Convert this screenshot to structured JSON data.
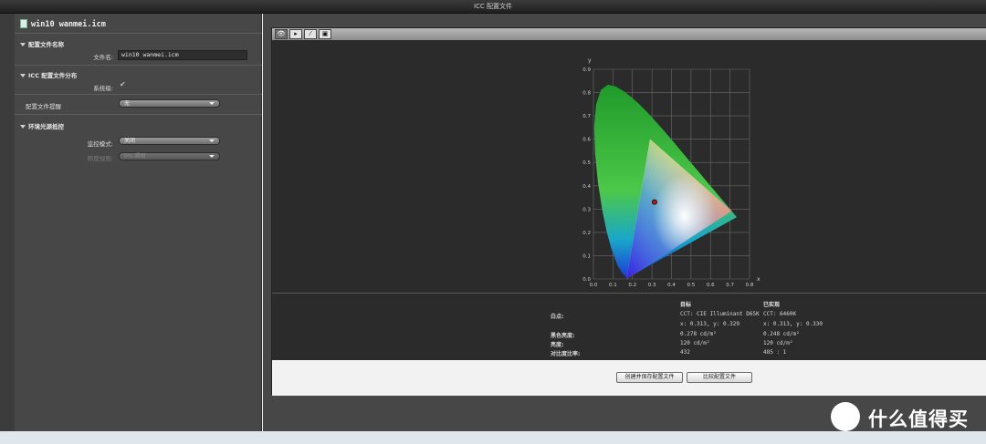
{
  "window": {
    "title": "ICC 配置文件"
  },
  "sidebar": {
    "file_title": "win10 wanmei.icm",
    "sec_name": "配置文件名称",
    "filename_label": "文件名:",
    "filename_value": "win10 wanmei.icm",
    "sec_dist": "ICC 配置文件分布",
    "system_label": "系统级:",
    "preview_label": "配置文件提醒",
    "preview_value": "无",
    "sec_ambient": "环境光源抵控",
    "monitor_label": "监控模式:",
    "monitor_value": "关闭",
    "lightlevel_label": "照度规则:",
    "lightlevel_value": "0% 照明"
  },
  "toolbar": {
    "tools": [
      "eye-icon",
      "cursor-icon",
      "curve-icon",
      "image-icon"
    ]
  },
  "chart_data": {
    "type": "scatter",
    "title": "",
    "xlabel": "x",
    "ylabel": "y",
    "xlim": [
      0.0,
      0.8
    ],
    "ylim": [
      0.0,
      0.9
    ],
    "x_ticks": [
      "0.0",
      "0.1",
      "0.2",
      "0.3",
      "0.4",
      "0.5",
      "0.6",
      "0.7",
      "0.8"
    ],
    "y_ticks": [
      "0.0",
      "0.1",
      "0.2",
      "0.3",
      "0.4",
      "0.5",
      "0.6",
      "0.7",
      "0.8",
      "0.9"
    ],
    "grid": true,
    "gamut_triangle": [
      [
        0.708,
        0.292
      ],
      [
        0.17,
        0.0
      ],
      [
        0.29,
        0.6
      ]
    ],
    "white_point": {
      "x": 0.313,
      "y": 0.33
    }
  },
  "info": {
    "col_target": "目标",
    "col_achieved": "已实现",
    "whitepoint_label": "白点:",
    "target_cct": "CCT: CIE Illuminant D65K",
    "target_xy": "x: 0.313, y: 0.329",
    "achieved_cct": "CCT: 6460K",
    "achieved_xy": "x: 0.313, y: 0.330",
    "black_label": "黑色亮度:",
    "target_black": "0.278 cd/m²",
    "achieved_black": "0.248 cd/m²",
    "lum_label": "亮度:",
    "target_lum": "120 cd/m²",
    "achieved_lum": "120 cd/m²",
    "contrast_label": "对比度比率:",
    "target_contrast": "432",
    "achieved_contrast": "485 : 1"
  },
  "footer": {
    "create_button": "创建并保存配置文件",
    "compare_button": "比较配置文件"
  },
  "watermark": {
    "text": "什么值得买"
  }
}
